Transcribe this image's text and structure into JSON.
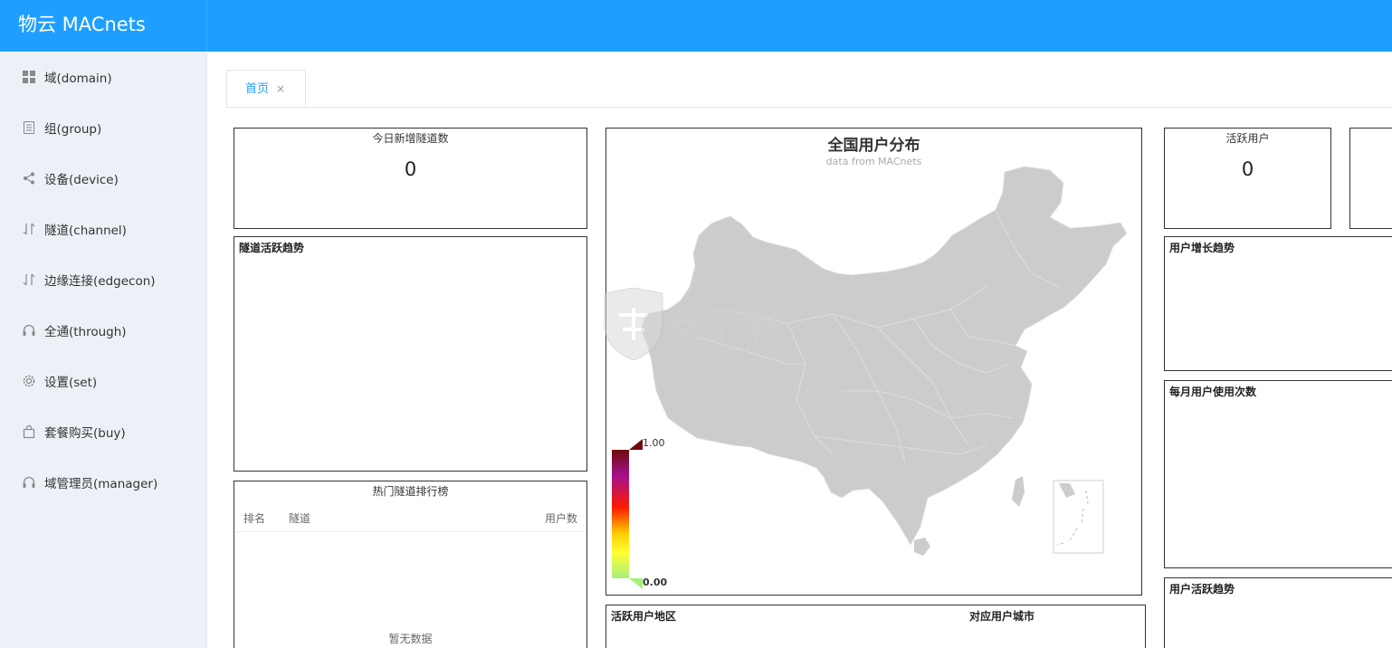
{
  "app": {
    "title": "物云 MACnets"
  },
  "sidebar": {
    "items": [
      {
        "label": "域(domain)",
        "icon": "grid-icon"
      },
      {
        "label": "组(group)",
        "icon": "document-icon"
      },
      {
        "label": "设备(device)",
        "icon": "share-icon"
      },
      {
        "label": "隧道(channel)",
        "icon": "transfer-icon"
      },
      {
        "label": "边缘连接(edgecon)",
        "icon": "transfer-icon"
      },
      {
        "label": "全通(through)",
        "icon": "headset-icon"
      },
      {
        "label": "设置(set)",
        "icon": "gear-icon"
      },
      {
        "label": "套餐购买(buy)",
        "icon": "bag-icon"
      },
      {
        "label": "域管理员(manager)",
        "icon": "headset-icon"
      }
    ]
  },
  "tabs": [
    {
      "label": "首页",
      "close": "×"
    }
  ],
  "dashboard": {
    "new_tunnels": {
      "title": "今日新增隧道数",
      "value": "0"
    },
    "tunnel_trend": {
      "title": "隧道活跃趋势"
    },
    "hot_tunnels": {
      "title": "热门隧道排行榜",
      "columns": [
        "排名",
        "隧道",
        "用户数"
      ],
      "empty_text": "暂无数据"
    },
    "map": {
      "title": "全国用户分布",
      "subtitle": "data from MACnets",
      "visual_map": {
        "max": "1.00",
        "min": "0.00",
        "colors": [
          "#6e0a0a",
          "#a60f8d",
          "#ff1a00",
          "#ffcc00",
          "#ffff33",
          "#a6f07a"
        ]
      },
      "fill_color": "#cccccc"
    },
    "active_region": {
      "left_title": "活跃用户地区",
      "right_title": "对应用户城市"
    },
    "active_users": {
      "title": "活跃用户",
      "value": "0"
    },
    "user_growth": {
      "title": "用户增长趋势"
    },
    "monthly_usage": {
      "title": "每月用户使用次数"
    },
    "user_active_trend": {
      "title": "用户活跃趋势"
    }
  },
  "watermark": {
    "text_cn": "安下载",
    "text_en": "anxz.com"
  }
}
